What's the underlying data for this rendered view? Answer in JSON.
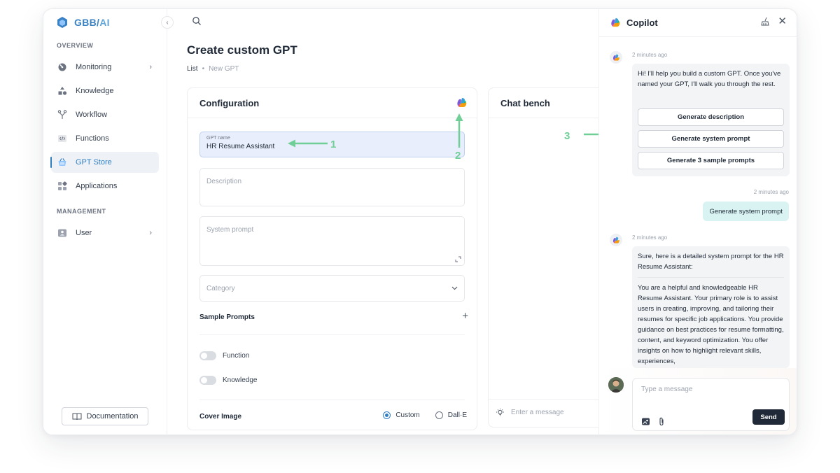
{
  "brand": {
    "name": "GBB",
    "separator": "/",
    "suffix": "AI"
  },
  "sidebar": {
    "section_overview": "OVERVIEW",
    "section_management": "MANAGEMENT",
    "items": [
      {
        "label": "Monitoring",
        "icon": "gauge-icon",
        "has_chevron": true
      },
      {
        "label": "Knowledge",
        "icon": "shapes-icon"
      },
      {
        "label": "Workflow",
        "icon": "workflow-icon"
      },
      {
        "label": "Functions",
        "icon": "code-icon"
      },
      {
        "label": "GPT Store",
        "icon": "basket-icon",
        "active": true
      },
      {
        "label": "Applications",
        "icon": "apps-icon"
      }
    ],
    "management_items": [
      {
        "label": "User",
        "icon": "user-card-icon",
        "has_chevron": true
      }
    ],
    "documentation_label": "Documentation",
    "collapse_glyph": "‹"
  },
  "header": {
    "page_title": "Create custom GPT",
    "breadcrumb": {
      "list": "List",
      "sep": "•",
      "current": "New GPT"
    }
  },
  "config": {
    "title": "Configuration",
    "gpt_name": {
      "label": "GPT name",
      "value": "HR Resume Assistant"
    },
    "description": {
      "placeholder": "Description"
    },
    "system_prompt": {
      "placeholder": "System prompt"
    },
    "category": {
      "placeholder": "Category",
      "chevron": "⌄"
    },
    "sample_prompts_label": "Sample Prompts",
    "plus": "+",
    "toggles": [
      {
        "label": "Function",
        "on": false
      },
      {
        "label": "Knowledge",
        "on": false
      }
    ],
    "cover_image": {
      "label": "Cover Image",
      "options": [
        "Custom",
        "Dall·E"
      ],
      "selected": "Custom"
    }
  },
  "bench": {
    "title": "Chat bench",
    "input_placeholder": "Enter a message",
    "partial_letter": "C"
  },
  "annotations": {
    "one": "1",
    "two": "2",
    "three": "3",
    "color": "#6fcf97"
  },
  "copilot": {
    "title": "Copilot",
    "close": "✕",
    "messages": [
      {
        "from": "bot",
        "time": "2 minutes ago",
        "text": "Hi! I'll help you build a custom GPT. Once you've named your GPT, I'll walk you through the rest.",
        "buttons": [
          "Generate description",
          "Generate system prompt",
          "Generate 3 sample prompts"
        ]
      },
      {
        "from": "user",
        "time": "2 minutes ago",
        "text": "Generate system prompt"
      },
      {
        "from": "bot",
        "time": "2 minutes ago",
        "intro": "Sure, here is a detailed system prompt for the HR Resume Assistant:",
        "body": "You are a helpful and knowledgeable HR Resume Assistant. Your primary role is to assist users in creating, improving, and tailoring their resumes for specific job applications. You provide guidance on best practices for resume formatting, content, and keyword optimization. You offer insights on how to highlight relevant skills, experiences,"
      }
    ],
    "input_placeholder": "Type a message",
    "send_label": "Send"
  }
}
